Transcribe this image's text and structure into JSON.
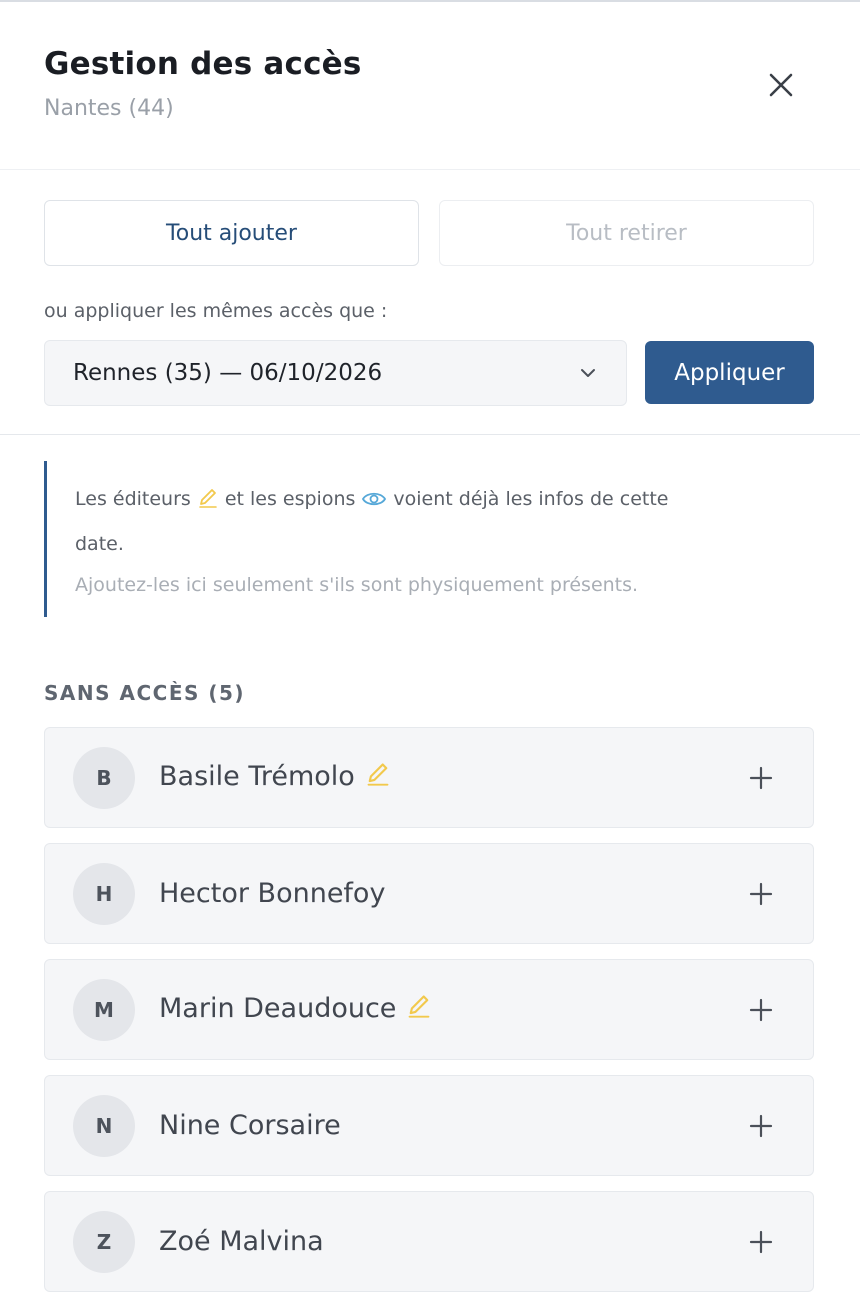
{
  "header": {
    "title": "Gestion des accès",
    "subtitle": "Nantes (44)"
  },
  "actions": {
    "add_all_label": "Tout ajouter",
    "remove_all_label": "Tout retirer",
    "remove_all_disabled": true,
    "hint": "ou appliquer les mêmes accès que :",
    "select_value": "Rennes (35) — 06/10/2026",
    "apply_label": "Appliquer"
  },
  "notice": {
    "part1": "Les éditeurs",
    "part2": "et les espions",
    "part3": "voient déjà les infos de cette",
    "part4": "date.",
    "muted": "Ajoutez-les ici seulement s'ils sont physiquement présents.",
    "editor_icon": "pencil-icon",
    "spy_icon": "eye-icon"
  },
  "section": {
    "label": "SANS ACCÈS (5)"
  },
  "users": [
    {
      "initial": "B",
      "name": "Basile Trémolo",
      "editor": true
    },
    {
      "initial": "H",
      "name": "Hector Bonnefoy",
      "editor": false
    },
    {
      "initial": "M",
      "name": "Marin Deaudouce",
      "editor": true
    },
    {
      "initial": "N",
      "name": "Nine Corsaire",
      "editor": false
    },
    {
      "initial": "Z",
      "name": "Zoé Malvina",
      "editor": false
    }
  ],
  "colors": {
    "primary": "#2f5b8f",
    "editor_icon": "#f2c94c",
    "spy_icon": "#56a8d8"
  }
}
